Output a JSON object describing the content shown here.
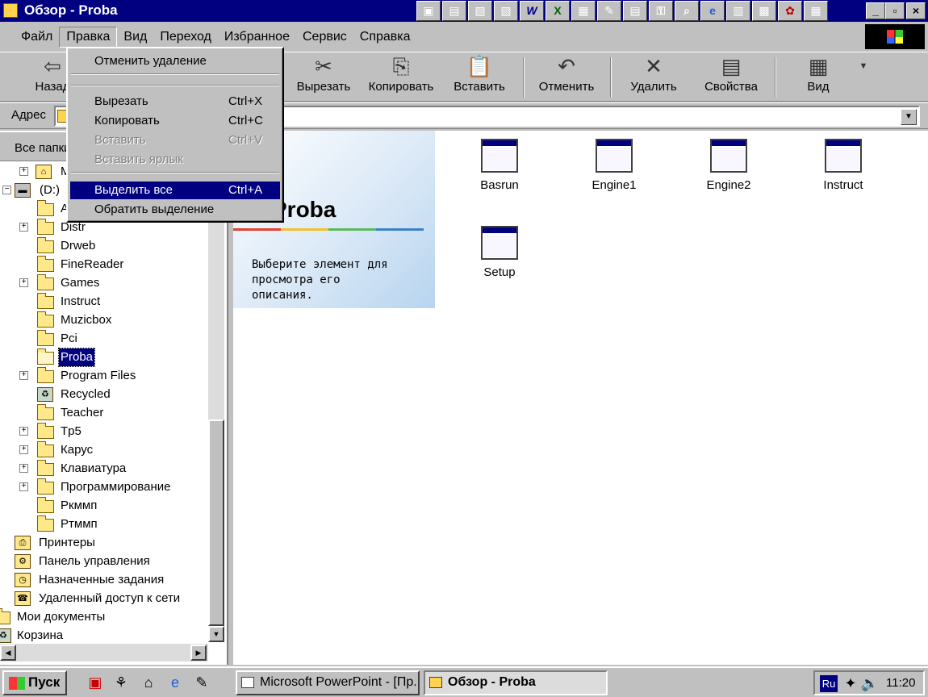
{
  "window": {
    "title": "Обзор - Proba",
    "controls": [
      "_",
      "▫",
      "×"
    ]
  },
  "quick_launch": [
    "▣",
    "▤",
    "▨",
    "▧",
    "W",
    "X",
    "▦",
    "✎",
    "▤",
    "⚿",
    "⌕",
    "e",
    "▥",
    "▩",
    "✿",
    "▦"
  ],
  "menubar": {
    "items": [
      "Файл",
      "Правка",
      "Вид",
      "Переход",
      "Избранное",
      "Сервис",
      "Справка"
    ],
    "active": "Правка"
  },
  "toolbar": {
    "back_label": "Назад",
    "cut_label": "Вырезать",
    "copy_label": "Копировать",
    "paste_label": "Вставить",
    "undo_label": "Отменить",
    "delete_label": "Удалить",
    "properties_label": "Свойства",
    "view_label": "Вид"
  },
  "address": {
    "label": "Адрес",
    "value": ""
  },
  "edit_menu": {
    "undo_delete": "Отменить удаление",
    "cut": "Вырезать",
    "cut_shortcut": "Ctrl+X",
    "copy": "Копировать",
    "copy_shortcut": "Ctrl+C",
    "paste": "Вставить",
    "paste_shortcut": "Ctrl+V",
    "paste_shortcut_link": "Вставить ярлык",
    "select_all": "Выделить все",
    "select_all_shortcut": "Ctrl+A",
    "invert_selection": "Обратить выделение"
  },
  "folder_tree": {
    "header": "Все папки",
    "items": [
      {
        "label": "М",
        "icon": "network-icon"
      },
      {
        "label": "(D:)",
        "icon": "drive-icon"
      },
      {
        "label": "A",
        "icon": "folder-icon"
      },
      {
        "label": "Distr",
        "icon": "folder-icon"
      },
      {
        "label": "Drweb",
        "icon": "folder-icon"
      },
      {
        "label": "FineReader",
        "icon": "folder-icon"
      },
      {
        "label": "Games",
        "icon": "folder-icon"
      },
      {
        "label": "Instruct",
        "icon": "folder-icon"
      },
      {
        "label": "Muzicbox",
        "icon": "folder-icon"
      },
      {
        "label": "Pci",
        "icon": "folder-icon"
      },
      {
        "label": "Proba",
        "icon": "open-folder-icon"
      },
      {
        "label": "Program Files",
        "icon": "folder-icon"
      },
      {
        "label": "Recycled",
        "icon": "recycle-bin-icon"
      },
      {
        "label": "Teacher",
        "icon": "folder-icon"
      },
      {
        "label": "Tp5",
        "icon": "folder-icon"
      },
      {
        "label": "Карус",
        "icon": "folder-icon"
      },
      {
        "label": "Клавиатура",
        "icon": "folder-icon"
      },
      {
        "label": "Программирование",
        "icon": "folder-icon"
      },
      {
        "label": "Ркммп",
        "icon": "folder-icon"
      },
      {
        "label": "Ртммп",
        "icon": "folder-icon"
      },
      {
        "label": "Принтеры",
        "icon": "printers-icon"
      },
      {
        "label": "Панель управления",
        "icon": "control-panel-icon"
      },
      {
        "label": "Назначенные задания",
        "icon": "scheduled-tasks-icon"
      },
      {
        "label": "Удаленный доступ к сети",
        "icon": "dialup-icon"
      },
      {
        "label": "Мои документы",
        "icon": "my-documents-icon"
      },
      {
        "label": "Корзина",
        "icon": "recycle-bin-icon"
      }
    ],
    "selected": "Proba"
  },
  "web_view": {
    "folder_title": "Proba",
    "description": "Выберите элемент для просмотра его описания."
  },
  "files": [
    {
      "name": "Basrun"
    },
    {
      "name": "Engine1"
    },
    {
      "name": "Engine2"
    },
    {
      "name": "Instruct"
    },
    {
      "name": "Setup"
    }
  ],
  "taskbar": {
    "start_label": "Пуск",
    "tasks": [
      {
        "label": "Microsoft PowerPoint - [Пр..."
      },
      {
        "label": "Обзор - Proba"
      }
    ],
    "language": "Ru",
    "clock": "11:20"
  }
}
